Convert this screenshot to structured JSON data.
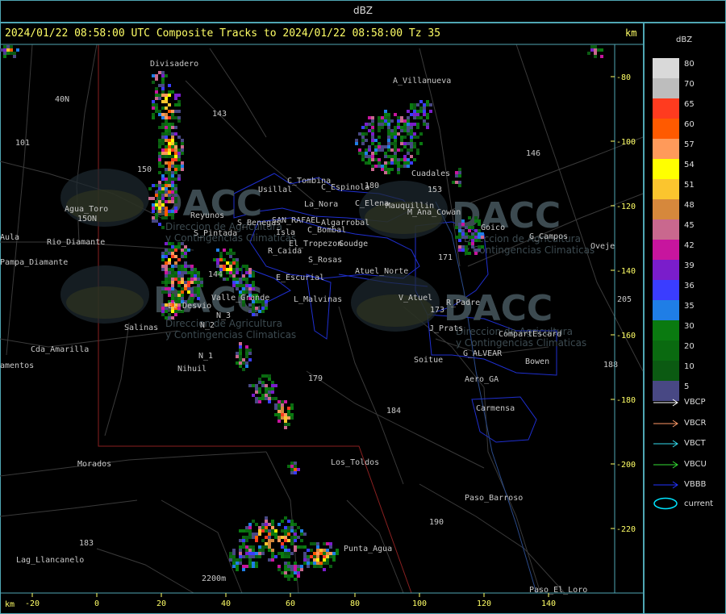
{
  "window": {
    "title": "dBZ"
  },
  "header": {
    "text": "2024/01/22 08:58:00 UTC Composite Tracks to 2024/01/22 08:58:00 Tz 35",
    "km_label": "km"
  },
  "axes": {
    "x_unit": "km",
    "y_unit": "km",
    "x_ticks": [
      "-20",
      "0",
      "20",
      "40",
      "60",
      "80",
      "100",
      "120",
      "140"
    ],
    "y_ticks": [
      "-80",
      "-100",
      "-120",
      "-140",
      "-160",
      "-180",
      "-200",
      "-220"
    ]
  },
  "legend": {
    "title": "dBZ",
    "levels": [
      {
        "value": "80",
        "color": "#d9d9d9"
      },
      {
        "value": "70",
        "color": "#bdbdbd"
      },
      {
        "value": "65",
        "color": "#ff3b1f"
      },
      {
        "value": "60",
        "color": "#ff5a00"
      },
      {
        "value": "57",
        "color": "#ff9a5a"
      },
      {
        "value": "54",
        "color": "#ffff00"
      },
      {
        "value": "51",
        "color": "#fbc52e"
      },
      {
        "value": "48",
        "color": "#d6883c"
      },
      {
        "value": "45",
        "color": "#c9688e"
      },
      {
        "value": "42",
        "color": "#c7159e"
      },
      {
        "value": "39",
        "color": "#7a1dcb"
      },
      {
        "value": "36",
        "color": "#3a3dff"
      },
      {
        "value": "35",
        "color": "#1f7ee6"
      },
      {
        "value": "30",
        "color": "#0a7a10"
      },
      {
        "value": "20",
        "color": "#0a6a10"
      },
      {
        "value": "10",
        "color": "#0b5a12"
      },
      {
        "value": "5",
        "color": "#484884"
      }
    ],
    "tracks": [
      {
        "name": "VBCP",
        "color": "#ffffff"
      },
      {
        "name": "VBCR",
        "color": "#ff9966"
      },
      {
        "name": "VBCT",
        "color": "#33ddee"
      },
      {
        "name": "VBCU",
        "color": "#33dd33"
      },
      {
        "name": "VBBB",
        "color": "#2233ff"
      }
    ],
    "current_label": "current",
    "current_color": "#00e5ff"
  },
  "places": [
    {
      "name": "Divisadero"
    },
    {
      "name": "A_Villanueva"
    },
    {
      "name": "Usillal"
    },
    {
      "name": "C_Tombina"
    },
    {
      "name": "C_Espinola"
    },
    {
      "name": "La_Nora"
    },
    {
      "name": "C_Elena"
    },
    {
      "name": "Mauquillin"
    },
    {
      "name": "Cuadales"
    },
    {
      "name": "M_Ana_Cowan"
    },
    {
      "name": "Goico"
    },
    {
      "name": "G_Campos"
    },
    {
      "name": "Oveje"
    },
    {
      "name": "Agua_Toro"
    },
    {
      "name": "Rio_Diamante"
    },
    {
      "name": "Pampa_Diamante"
    },
    {
      "name": "Aula"
    },
    {
      "name": "Reyunos"
    },
    {
      "name": "S_Pintada"
    },
    {
      "name": "S_Benegas"
    },
    {
      "name": "SAN_RAFAEL"
    },
    {
      "name": "Algarrobal"
    },
    {
      "name": "C_Bombal"
    },
    {
      "name": "Isla"
    },
    {
      "name": "El_Tropezon"
    },
    {
      "name": "Goudge"
    },
    {
      "name": "R_Caida"
    },
    {
      "name": "S_Rosas"
    },
    {
      "name": "Atuel_Norte"
    },
    {
      "name": "E_Escurial"
    },
    {
      "name": "L_Malvinas"
    },
    {
      "name": "V_Atuel"
    },
    {
      "name": "R_Padre"
    },
    {
      "name": "Valle_Grande"
    },
    {
      "name": "El_Desvio"
    },
    {
      "name": "Salinas"
    },
    {
      "name": "N_2"
    },
    {
      "name": "N_3"
    },
    {
      "name": "N_1"
    },
    {
      "name": "Nihuil"
    },
    {
      "name": "J_Prats"
    },
    {
      "name": "CompartEscard"
    },
    {
      "name": "G_ALVEAR"
    },
    {
      "name": "Bowen"
    },
    {
      "name": "Soitue"
    },
    {
      "name": "Aero_GA"
    },
    {
      "name": "Carmensa"
    },
    {
      "name": "Cda_Amarilla"
    },
    {
      "name": "amentos"
    },
    {
      "name": "Los_Toldos"
    },
    {
      "name": "Morados"
    },
    {
      "name": "Paso_Barroso"
    },
    {
      "name": "Lag_Llancanelo"
    },
    {
      "name": "Punta_Agua"
    },
    {
      "name": "Paso_El_Loro"
    },
    {
      "name": "Las_Malvinas"
    }
  ],
  "route_numbers": [
    "143",
    "146",
    "153",
    "171",
    "173",
    "180",
    "184",
    "179",
    "190",
    "188",
    "183",
    "205",
    "101",
    "40N",
    "15ON",
    "144",
    "150",
    "2200m"
  ],
  "watermark": {
    "brand": "DACC",
    "line1": "Direccion de Agricultura",
    "line2": "y Contingencias Climaticas"
  }
}
